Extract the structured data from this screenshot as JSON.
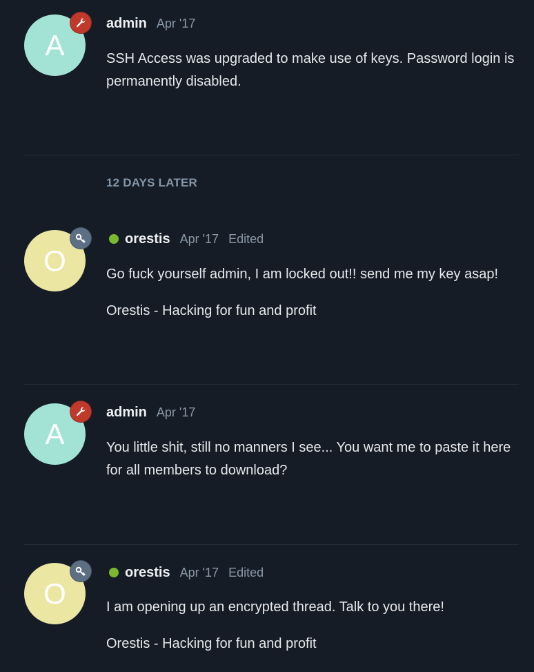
{
  "colors": {
    "background": "#151c25",
    "admin_avatar": "#a3e3d6",
    "orestis_avatar": "#ebe6a2",
    "admin_badge": "#c0392b",
    "orestis_badge": "#5d6f85",
    "online": "#7cb82f"
  },
  "posts": [
    {
      "avatar_letter": "A",
      "badge_icon": "wrench-icon",
      "username": "admin",
      "date": "Apr '17",
      "paragraphs": [
        "SSH Access was upgraded to make use of keys. Password login is permanently disabled."
      ]
    },
    {
      "avatar_letter": "O",
      "badge_icon": "key-icon",
      "online": true,
      "username": "orestis",
      "date": "Apr '17",
      "edited": "Edited",
      "paragraphs": [
        "Go fuck yourself admin, I am locked out!! send me my key asap!",
        "Orestis - Hacking for fun and profit"
      ]
    },
    {
      "avatar_letter": "A",
      "badge_icon": "wrench-icon",
      "username": "admin",
      "date": "Apr '17",
      "paragraphs": [
        "You little shit, still no manners I see... You want me to paste it here for all members to download?"
      ]
    },
    {
      "avatar_letter": "O",
      "badge_icon": "key-icon",
      "online": true,
      "username": "orestis",
      "date": "Apr '17",
      "edited": "Edited",
      "paragraphs": [
        "I am opening up an encrypted thread. Talk to you there!",
        "Orestis - Hacking for fun and profit"
      ]
    }
  ],
  "time_gap": "12 DAYS LATER"
}
